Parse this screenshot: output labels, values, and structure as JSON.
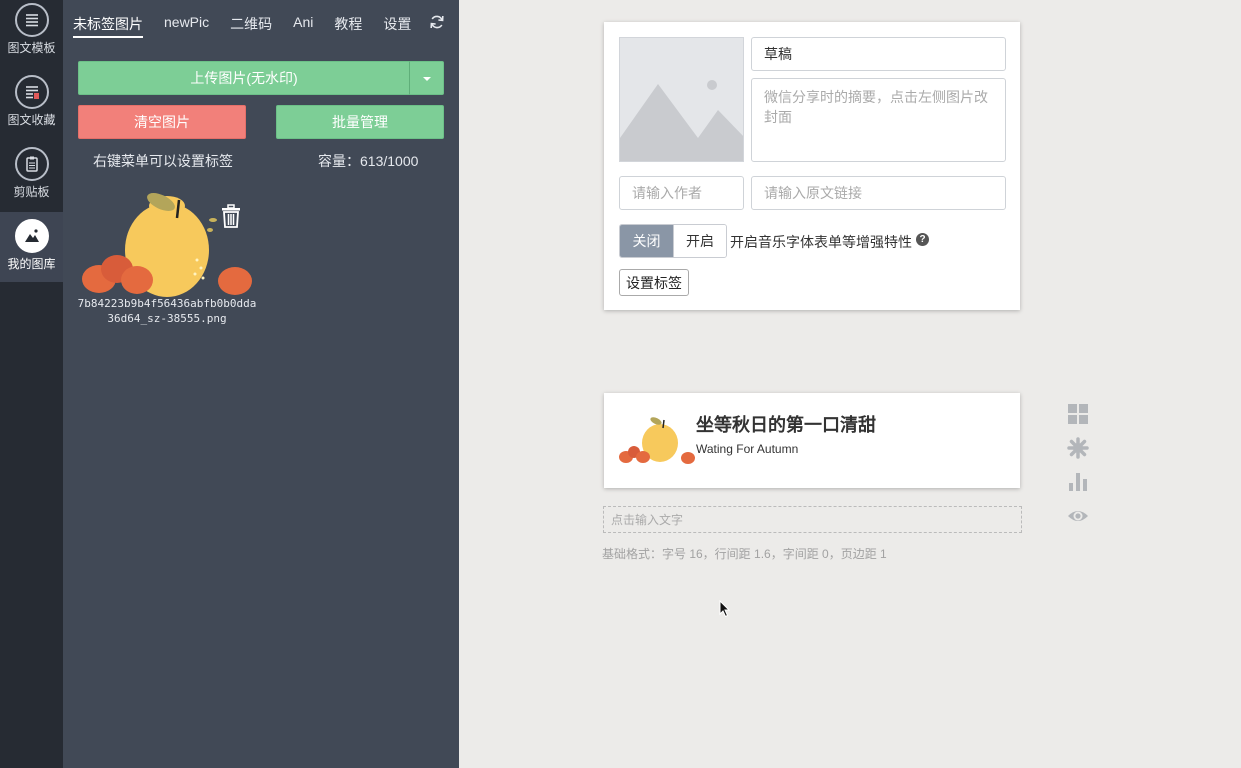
{
  "rail": {
    "items": [
      {
        "label": "图文模板",
        "icon": "list-icon"
      },
      {
        "label": "图文收藏",
        "icon": "bookmark-list-icon"
      },
      {
        "label": "剪贴板",
        "icon": "clipboard-icon"
      },
      {
        "label": "我的图库",
        "icon": "image-gallery-icon",
        "active": true
      }
    ]
  },
  "library": {
    "tabs": [
      {
        "label": "未标签图片",
        "active": true
      },
      {
        "label": "newPic"
      },
      {
        "label": "二维码"
      },
      {
        "label": "Ani"
      },
      {
        "label": "教程"
      },
      {
        "label": "设置"
      }
    ],
    "upload_label": "上传图片(无水印)",
    "clear_label": "清空图片",
    "batch_label": "批量管理",
    "hint": "右键菜单可以设置标签",
    "capacity": "容量：613/1000",
    "image_filename": "7b84223b9b4f56436abfb0b0dda36d64_sz-38555.png"
  },
  "meta": {
    "title_value": "草稿",
    "summary_placeholder": "微信分享时的摘要，点击左侧图片改封面",
    "author_placeholder": "请输入作者",
    "link_placeholder": "请输入原文链接",
    "toggle_off": "关闭",
    "toggle_on": "开启",
    "enhance_label": "开启音乐字体表单等增强特性",
    "tag_button": "设置标签"
  },
  "article": {
    "title": "坐等秋日的第一口清甜",
    "subtitle": "Wating For Autumn"
  },
  "editor": {
    "input_placeholder": "点击输入文字",
    "base_format": "基础格式：字号 16，行间距 1.6，字间距 0，页边距 1"
  },
  "toolbar": {
    "icons": [
      "grid-icon",
      "gear-icon",
      "bar-chart-icon",
      "eye-icon"
    ]
  },
  "colors": {
    "green": "#7dce96",
    "red": "#f2807a",
    "panel": "#414956",
    "rail": "#262b33"
  }
}
